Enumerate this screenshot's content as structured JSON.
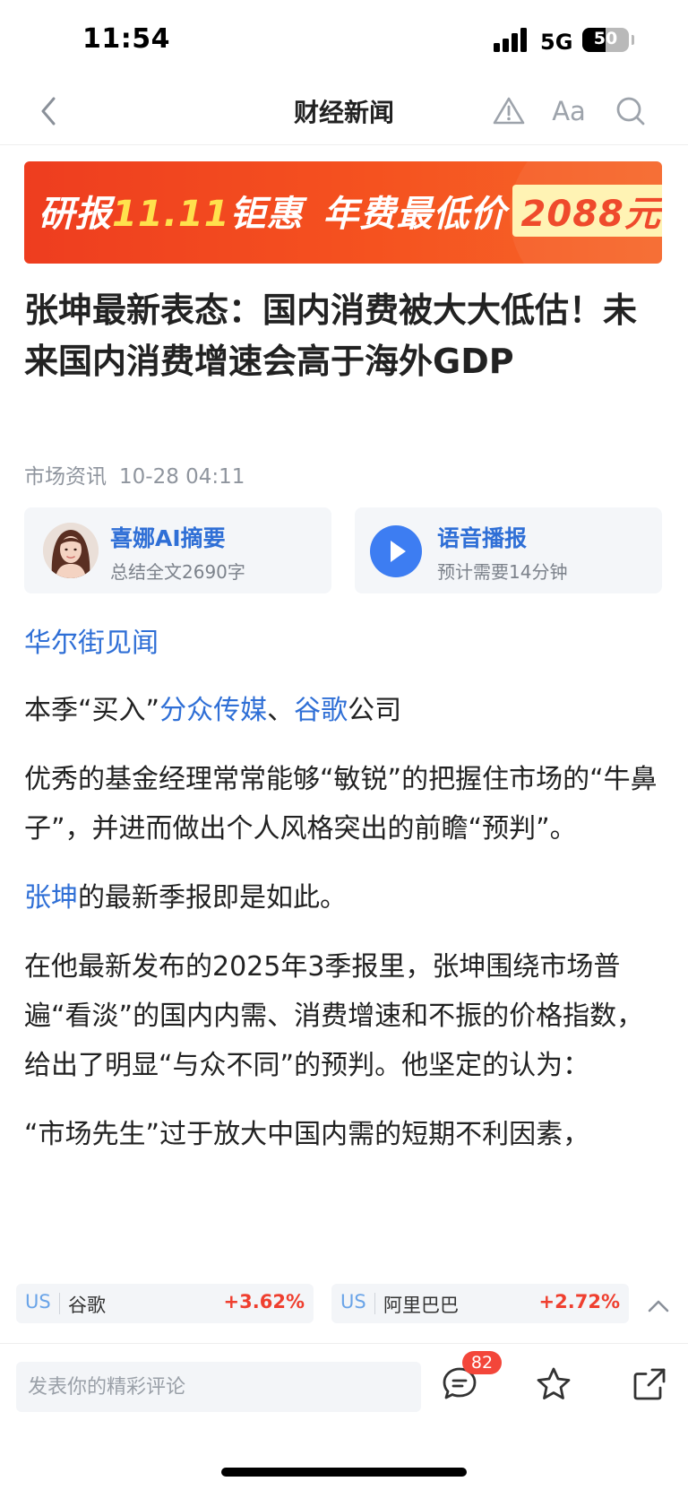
{
  "status_bar": {
    "time": "11:54",
    "network": "5G",
    "battery_level": "50",
    "battery_fraction": 0.5
  },
  "nav": {
    "title": "财经新闻",
    "font_icon_label": "Aa",
    "icons": [
      "back-arrow-icon",
      "warning-icon",
      "font-size-icon",
      "search-icon"
    ]
  },
  "banner": {
    "part1": "研报",
    "part2": "11.11",
    "part3": "钜惠",
    "part4": "年费最低价",
    "price": "2088元",
    "colors": {
      "background": "#f04a20",
      "highlight": "#ffe14d"
    }
  },
  "article": {
    "title": "张坤最新表态：国内消费被大大低估！未来国内消费增速会高于海外GDP",
    "source": "市场资讯",
    "datetime": "10-28 04:11",
    "author": "华尔街见闻",
    "p1": {
      "a": "本季“买入”",
      "link1": "分众传媒",
      "b": "、",
      "link2": "谷歌",
      "c": "公司"
    },
    "p2": "优秀的基金经理常常能够“敏锐”的把握住市场的“牛鼻子”，并进而做出个人风格突出的前瞻“预判”。",
    "p3": {
      "link": "张坤",
      "text": "的最新季报即是如此。"
    },
    "p4": "在他最新发布的2025年3季报里，张坤围绕市场普遍“看淡”的国内内需、消费增速和不振的价格指数，给出了明显“与众不同”的预判。他坚定的认为：",
    "p5": "“市场先生”过于放大中国内需的短期不利因素，"
  },
  "cards": {
    "ai": {
      "title": "喜娜AI摘要",
      "subtitle": "总结全文2690字"
    },
    "audio": {
      "title": "语音播报",
      "subtitle": "预计需要14分钟"
    }
  },
  "stocks": [
    {
      "market": "US",
      "name": "谷歌",
      "change": "+3.62%"
    },
    {
      "market": "US",
      "name": "阿里巴巴",
      "change": "+2.72%"
    }
  ],
  "bottom_bar": {
    "comment_placeholder": "发表你的精彩评论",
    "comment_count": "82",
    "icons": [
      "comment-icon",
      "star-icon",
      "share-icon"
    ]
  },
  "colors": {
    "link": "#2f6fd6",
    "up": "#ef3f2f",
    "badge": "#f3463a"
  }
}
